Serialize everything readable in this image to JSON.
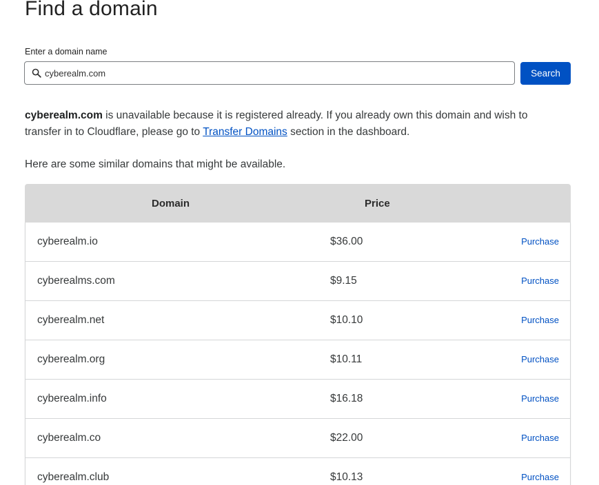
{
  "page": {
    "title": "Find a domain"
  },
  "search": {
    "label": "Enter a domain name",
    "value": "cyberealm.com",
    "button_label": "Search",
    "icon": "search-icon"
  },
  "message": {
    "domain": "cyberealm.com",
    "text_before_link": " is unavailable because it is registered already. If you already own this domain and wish to transfer in to Cloudflare, please go to ",
    "link_text": "Transfer Domains",
    "text_after_link": " section in the dashboard."
  },
  "suggestions_intro": "Here are some similar domains that might be available.",
  "table": {
    "headers": {
      "domain": "Domain",
      "price": "Price"
    },
    "rows": [
      {
        "domain": "cyberealm.io",
        "price": "$36.00",
        "action": "Purchase"
      },
      {
        "domain": "cyberealms.com",
        "price": "$9.15",
        "action": "Purchase"
      },
      {
        "domain": "cyberealm.net",
        "price": "$10.10",
        "action": "Purchase"
      },
      {
        "domain": "cyberealm.org",
        "price": "$10.11",
        "action": "Purchase"
      },
      {
        "domain": "cyberealm.info",
        "price": "$16.18",
        "action": "Purchase"
      },
      {
        "domain": "cyberealm.co",
        "price": "$22.00",
        "action": "Purchase"
      },
      {
        "domain": "cyberealm.club",
        "price": "$10.13",
        "action": "Purchase"
      }
    ]
  },
  "colors": {
    "accent": "#0051c3",
    "header_bg": "#d9d9d9",
    "text": "#36393a"
  }
}
